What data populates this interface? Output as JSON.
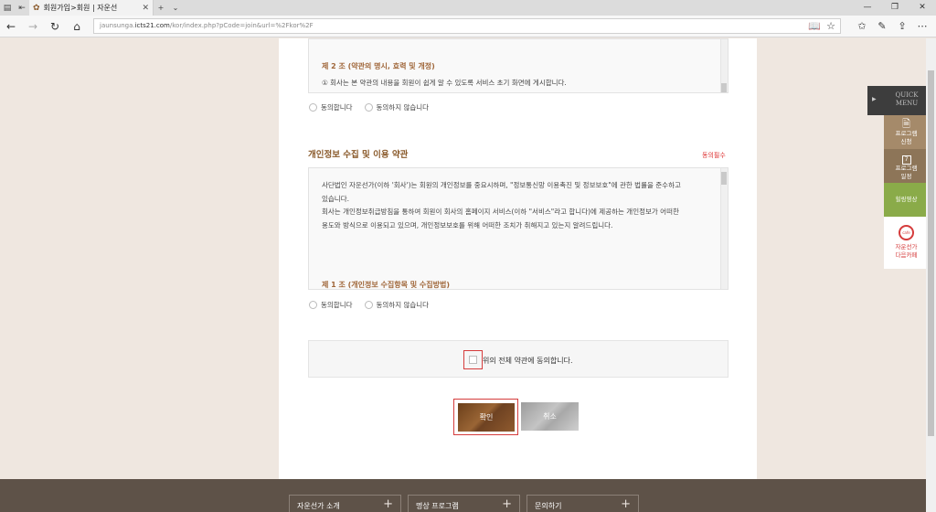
{
  "browser": {
    "tab_title": "회원가입>회원 | 자운선",
    "url_prefix": "jaunsunga.",
    "url_domain": "icts21.com",
    "url_path": "/kor/index.php?pCode=join&url=%2Fkor%2F"
  },
  "terms1": {
    "article_title": "제 2 조 (약관의 명시, 효력 및 개정)",
    "line1": "① 회사는 본 약관의 내용을 회원이 쉽게 알 수 있도록 서비스 초기 화면에 게시합니다.",
    "agree_label": "동의합니다",
    "disagree_label": "동의하지 않습니다"
  },
  "privacy": {
    "section_title": "개인정보 수집 및 이용 약관",
    "required_label": "동의필수",
    "para1": "사단법인 자운선가(이하 '회사')는 회원의 개인정보를 중요시하며, \"정보통신망 이용촉진 및 정보보호\"에 관한 법률을 준수하고",
    "para1b": "있습니다.",
    "para2": "회사는 개인정보취급방침을 통하여 회원이 회사의 홈페이지 서비스(이하 \"서비스\"라고 합니다)에 제공하는 개인정보가 어떠한",
    "para2b": "용도와 방식으로 이용되고 있으며, 개인정보보호를 위해 어떠한 조치가 취해지고 있는지 알려드립니다.",
    "article_title": "제 1 조 (개인정보 수집항목 및 수집방법)",
    "agree_label": "동의합니다",
    "disagree_label": "동의하지 않습니다"
  },
  "agree_all": {
    "label": "위의 전체 약관에 동의합니다."
  },
  "buttons": {
    "confirm": "확인",
    "cancel": "취소"
  },
  "footer": {
    "items": [
      "자운선가 소개",
      "명상 프로그램",
      "문의하기"
    ]
  },
  "quick_menu": {
    "title_line1": "QUICK",
    "title_line2": "MENU",
    "program_apply": [
      "프로그램",
      "신청"
    ],
    "program_schedule": [
      "프로그램",
      "일정"
    ],
    "schedule_day": "7",
    "promo_video": "힐링영상",
    "cafe_logo": "cafe",
    "cafe": [
      "자운선가",
      "다음카페"
    ]
  }
}
